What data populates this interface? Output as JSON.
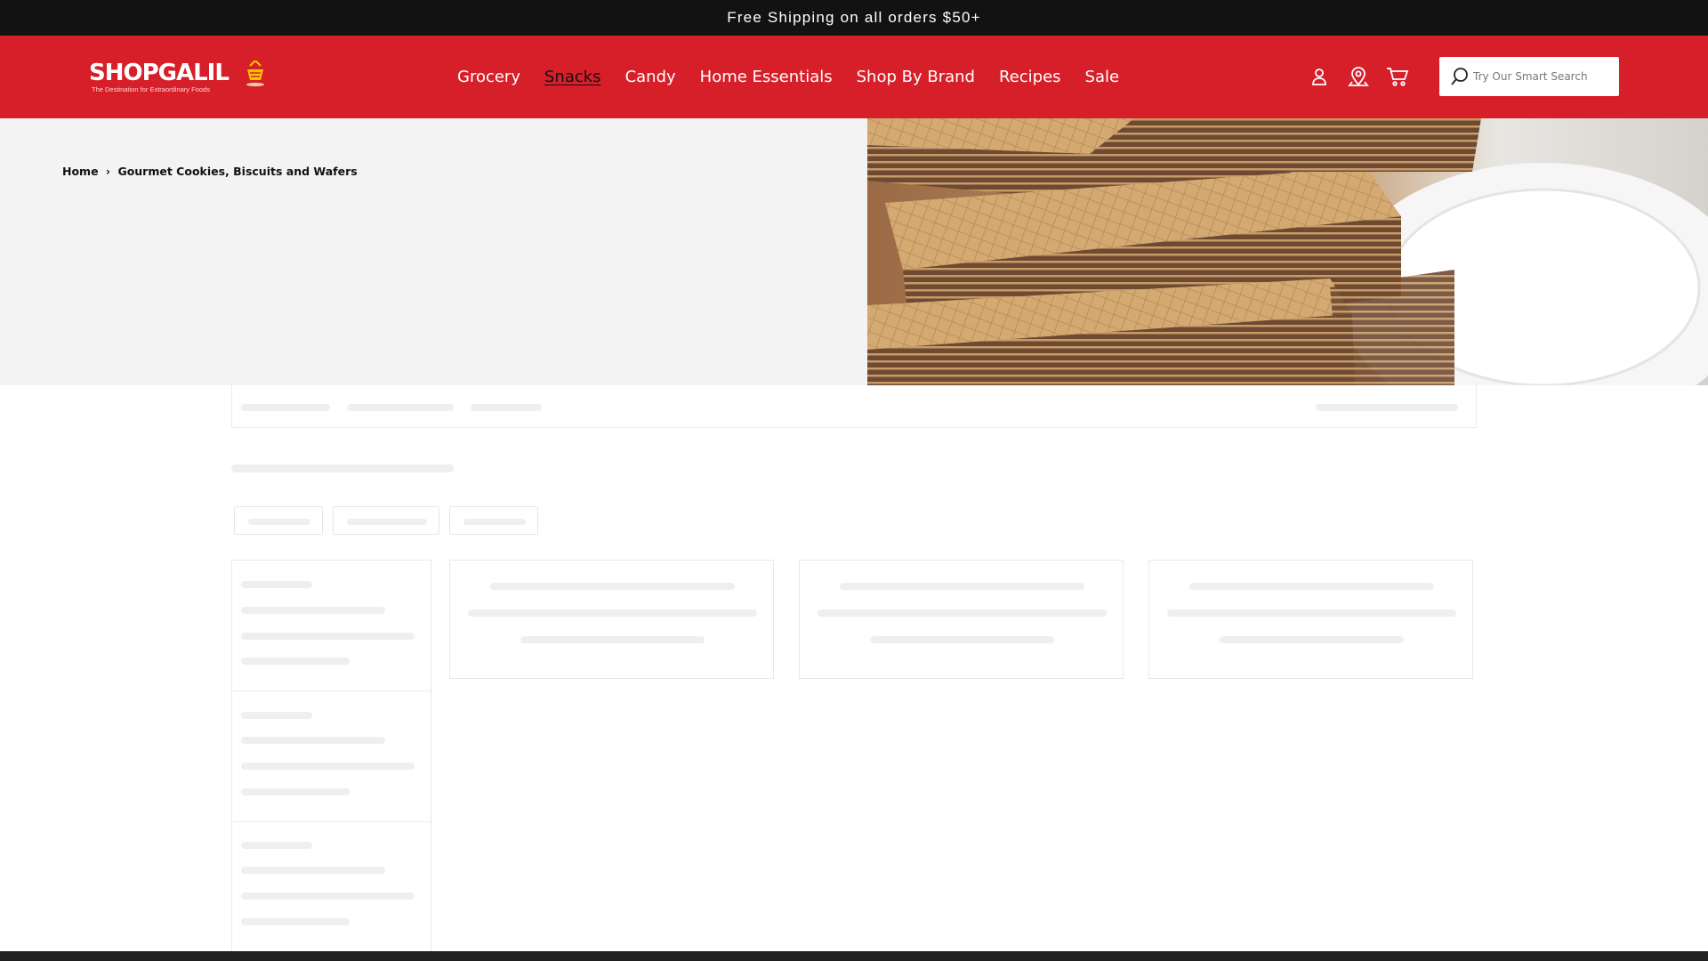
{
  "announcement": {
    "text": "Free Shipping on all orders $50+"
  },
  "header": {
    "logo": {
      "text": "SHOPGALIL",
      "tagline": "The Destination for Extraordinary Foods"
    },
    "nav": [
      {
        "label": "Grocery",
        "active": false
      },
      {
        "label": "Snacks",
        "active": true
      },
      {
        "label": "Candy",
        "active": false
      },
      {
        "label": "Home Essentials",
        "active": false
      },
      {
        "label": "Shop By Brand",
        "active": false
      },
      {
        "label": "Recipes",
        "active": false
      },
      {
        "label": "Sale",
        "active": false
      }
    ],
    "icons": [
      "account-icon",
      "store-locator-icon",
      "cart-icon"
    ],
    "search": {
      "placeholder": "Try Our Smart Search",
      "value": ""
    }
  },
  "breadcrumb": {
    "home": "Home",
    "separator": "›",
    "current": "Gourmet Cookies, Biscuits and Wafers"
  },
  "colors": {
    "brand_red": "#d71f2a",
    "announcement_bg": "#121212",
    "hero_bg": "#f3f3f3",
    "skeleton": "#efefef"
  }
}
